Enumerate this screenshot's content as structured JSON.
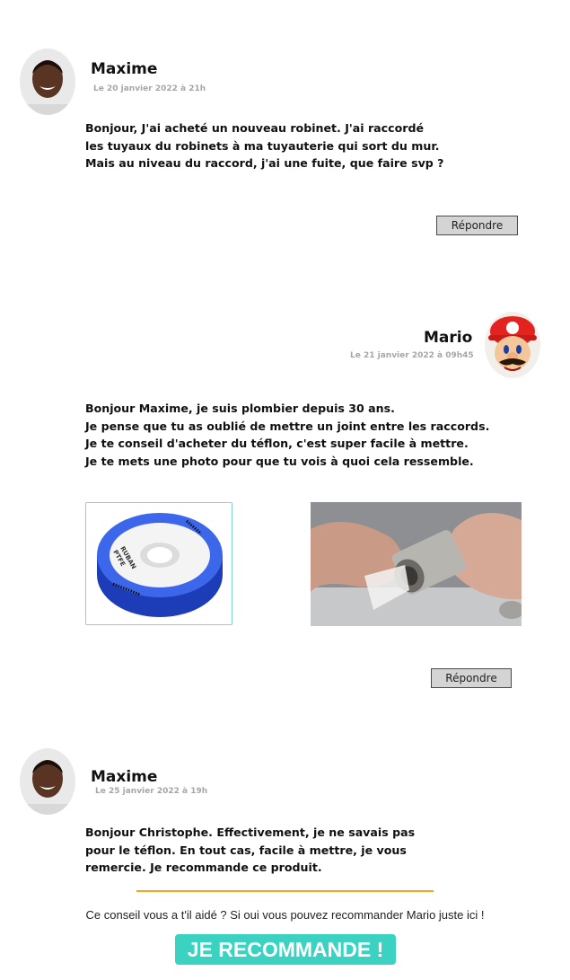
{
  "comments": [
    {
      "author": "Maxime",
      "date": "Le 20 janvier 2022 à 21h",
      "lines": [
        "Bonjour, J'ai acheté un nouveau robinet. J'ai raccordé",
        "les tuyaux du robinets à ma tuyauterie qui sort du mur.",
        "Mais au niveau du raccord, j'ai une fuite, que faire svp ?"
      ],
      "reply_label": "Répondre",
      "avatar_icon": "person-avatar"
    },
    {
      "author": "Mario",
      "date": "Le 21 janvier 2022 à 09h45",
      "lines": [
        "Bonjour Maxime, je suis plombier depuis 30 ans.",
        "Je pense que tu as oublié de mettre un joint entre les raccords.",
        "Je te conseil d'acheter du téflon, c'est super facile à mettre.",
        "Je te mets une photo pour que tu vois à quoi cela ressemble."
      ],
      "reply_label": "Répondre",
      "avatar_icon": "mario-avatar",
      "photos": {
        "tape_label_1": "RUBAN",
        "tape_label_2": "PTFE"
      }
    },
    {
      "author": "Maxime",
      "date": "Le 25 janvier 2022 à 19h",
      "lines": [
        "Bonjour Christophe. Effectivement, je ne savais pas",
        "pour le téflon. En tout cas, facile à mettre, je vous",
        "remercie. Je recommande ce produit."
      ],
      "avatar_icon": "person-avatar"
    }
  ],
  "cta": {
    "text": "Ce conseil vous a t'il aidé ? Si oui vous pouvez recommander Mario juste ici !",
    "button_label": "JE RECOMMANDE !"
  },
  "colors": {
    "accent": "#3bd2c1",
    "divider": "#f0a81f",
    "date_gray": "#a6a6a6",
    "button_gray": "#d4d4d4"
  }
}
